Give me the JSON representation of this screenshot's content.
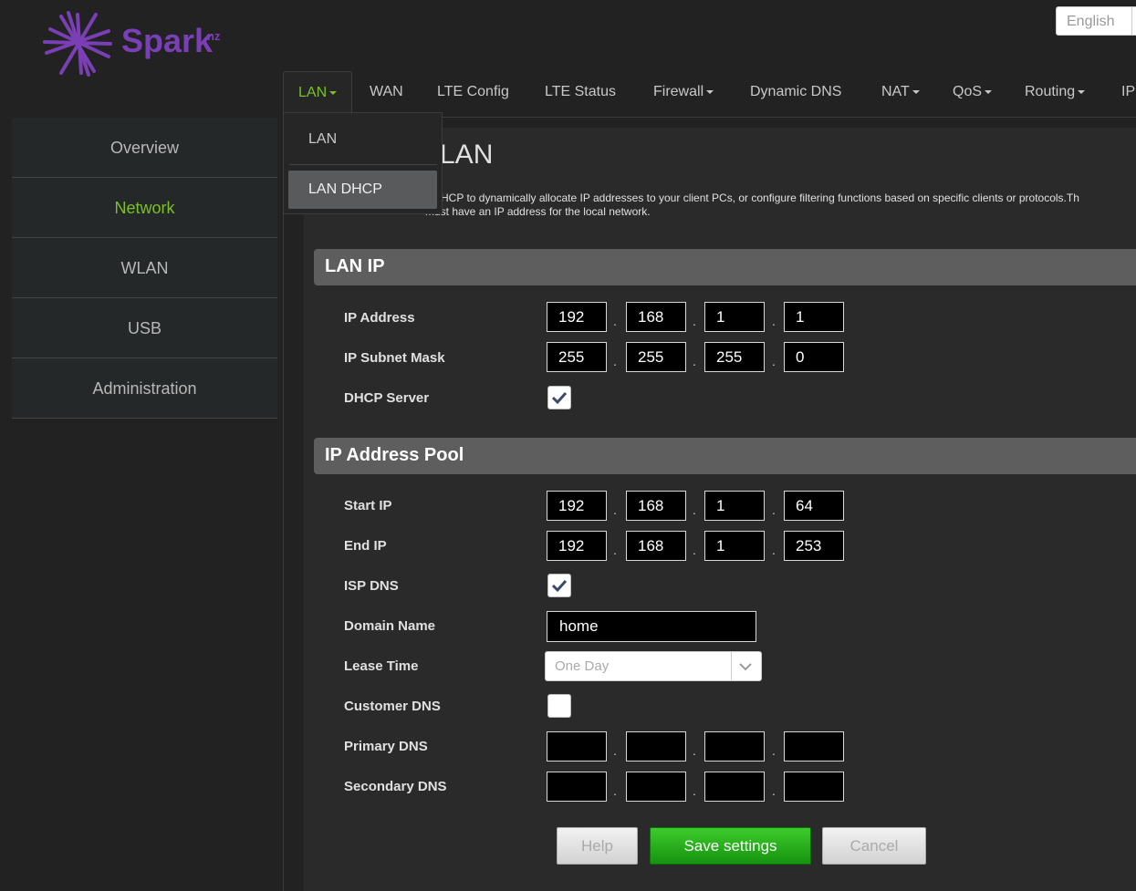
{
  "brand": {
    "name": "Spark",
    "suffix": "nz",
    "color": "#7a3fb5"
  },
  "language": {
    "selected": "English"
  },
  "topnav": {
    "tabs": [
      {
        "label": "LAN",
        "dropdown": true,
        "active": true
      },
      {
        "label": "WAN"
      },
      {
        "label": "LTE Config"
      },
      {
        "label": "LTE Status"
      },
      {
        "label": "Firewall",
        "dropdown": true
      },
      {
        "label": "Dynamic DNS"
      },
      {
        "label": "NAT",
        "dropdown": true
      },
      {
        "label": "QoS",
        "dropdown": true
      },
      {
        "label": "Routing",
        "dropdown": true
      },
      {
        "label": "IP"
      }
    ],
    "dropdown": {
      "items": [
        "LAN",
        "LAN DHCP"
      ],
      "active": "LAN DHCP"
    }
  },
  "sidebar": {
    "items": [
      {
        "label": "Overview"
      },
      {
        "label": "Network",
        "active": true
      },
      {
        "label": "WLAN"
      },
      {
        "label": "USB"
      },
      {
        "label": "Administration"
      }
    ]
  },
  "page": {
    "title": "LAN",
    "description_line1": "HCP to dynamically allocate IP addresses to your client PCs, or configure filtering functions based on specific clients or protocols.Th",
    "description_line2": "must have an IP address for the local network."
  },
  "lan_ip": {
    "heading": "LAN IP",
    "ip_address": {
      "label": "IP Address",
      "octets": [
        "192",
        "168",
        "1",
        "1"
      ]
    },
    "subnet_mask": {
      "label": "IP Subnet Mask",
      "octets": [
        "255",
        "255",
        "255",
        "0"
      ]
    },
    "dhcp_server": {
      "label": "DHCP Server",
      "checked": true
    }
  },
  "pool": {
    "heading": "IP Address Pool",
    "start_ip": {
      "label": "Start IP",
      "octets": [
        "192",
        "168",
        "1",
        "64"
      ]
    },
    "end_ip": {
      "label": "End IP",
      "octets": [
        "192",
        "168",
        "1",
        "253"
      ]
    },
    "isp_dns": {
      "label": "ISP DNS",
      "checked": true
    },
    "domain_name": {
      "label": "Domain Name",
      "value": "home"
    },
    "lease_time": {
      "label": "Lease Time",
      "value": "One Day"
    },
    "customer_dns": {
      "label": "Customer DNS",
      "checked": false
    },
    "primary_dns": {
      "label": "Primary DNS",
      "octets": [
        "",
        "",
        "",
        ""
      ]
    },
    "secondary_dns": {
      "label": "Secondary DNS",
      "octets": [
        "",
        "",
        "",
        ""
      ]
    }
  },
  "buttons": {
    "help": "Help",
    "save": "Save settings",
    "cancel": "Cancel"
  },
  "colors": {
    "accent_green": "#7bbf2a",
    "save_green": "#2fb01f",
    "background": "#222222"
  }
}
